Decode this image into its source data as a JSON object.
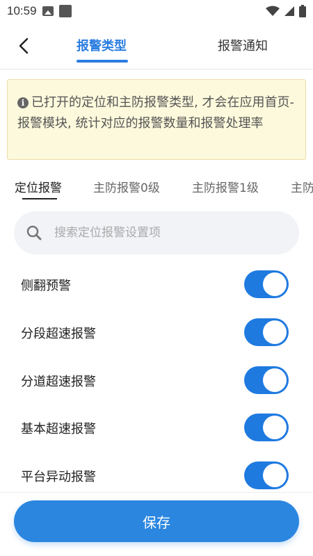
{
  "status_bar": {
    "time": "10:59"
  },
  "nav": {
    "tabs": [
      {
        "label": "报警类型",
        "active": true
      },
      {
        "label": "报警通知",
        "active": false
      }
    ]
  },
  "notice": {
    "text": "已打开的定位和主防报警类型, 才会在应用首页-报警模块, 统计对应的报警数量和报警处理率"
  },
  "sub_tabs": [
    {
      "label": "定位报警",
      "active": true
    },
    {
      "label": "主防报警0级",
      "active": false
    },
    {
      "label": "主防报警1级",
      "active": false
    },
    {
      "label": "主防",
      "active": false
    }
  ],
  "search": {
    "placeholder": "搜索定位报警设置项",
    "value": ""
  },
  "alarms": [
    {
      "label": "侧翻预警",
      "enabled": true
    },
    {
      "label": "分段超速报警",
      "enabled": true
    },
    {
      "label": "分道超速报警",
      "enabled": true
    },
    {
      "label": "基本超速报警",
      "enabled": true
    },
    {
      "label": "平台异动报警",
      "enabled": true
    }
  ],
  "save_button": {
    "label": "保存"
  },
  "colors": {
    "accent": "#2b7de0",
    "toggle_on": "#1f7ae0",
    "notice_bg": "#fdf9dc"
  }
}
